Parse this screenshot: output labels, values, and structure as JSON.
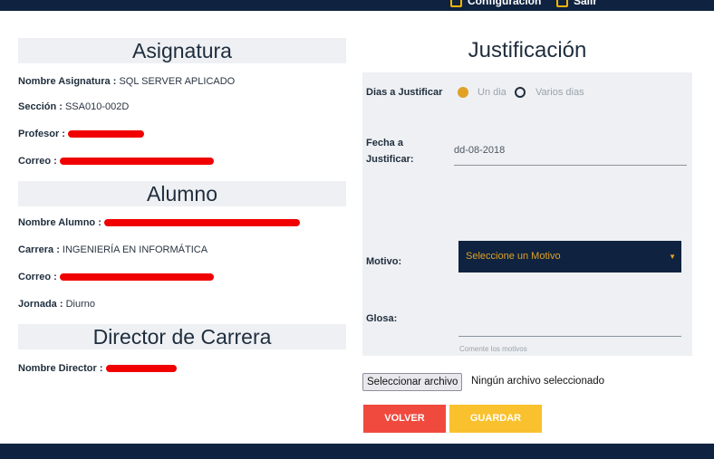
{
  "topbar": {
    "config_label": "Configuración",
    "exit_label": "Salir"
  },
  "asignatura": {
    "heading": "Asignatura",
    "nombre_label": "Nombre Asignatura :",
    "nombre_value": "SQL SERVER APLICADO",
    "seccion_label": "Sección :",
    "seccion_value": "SSA010-002D",
    "profesor_label": "Profesor :",
    "correo_label": "Correo :"
  },
  "alumno": {
    "heading": "Alumno",
    "nombre_label": "Nombre Alumno :",
    "carrera_label": "Carrera :",
    "carrera_value": "INGENIERÍA EN INFORMÁTICA",
    "correo_label": "Correo :",
    "jornada_label": "Jornada :",
    "jornada_value": "Diurno"
  },
  "director": {
    "heading": "Director de Carrera",
    "nombre_label": "Nombre Director :"
  },
  "justificacion": {
    "heading": "Justificación",
    "dias_label": "Dias a Justificar",
    "option_un_dia": "Un dia",
    "option_varios": "Varios dias",
    "selected_option": "Un dia",
    "fecha_label_1": "Fecha a",
    "fecha_label_2": "Justificar:",
    "fecha_value": "dd-08-2018",
    "motivo_label": "Motivo:",
    "motivo_selected": "Seleccione un Motivo",
    "glosa_label": "Glosa:",
    "glosa_hint": "Comente los motivos"
  },
  "file": {
    "button_label": "Seleccionar archivo",
    "status": "Ningún archivo seleccionado"
  },
  "actions": {
    "volver": "VOLVER",
    "guardar": "GUARDAR"
  },
  "colors": {
    "navy": "#0f2340",
    "accent": "#e0a224",
    "volver": "#f04a3e",
    "guardar": "#f9c12e",
    "panel": "#eef0f3"
  }
}
